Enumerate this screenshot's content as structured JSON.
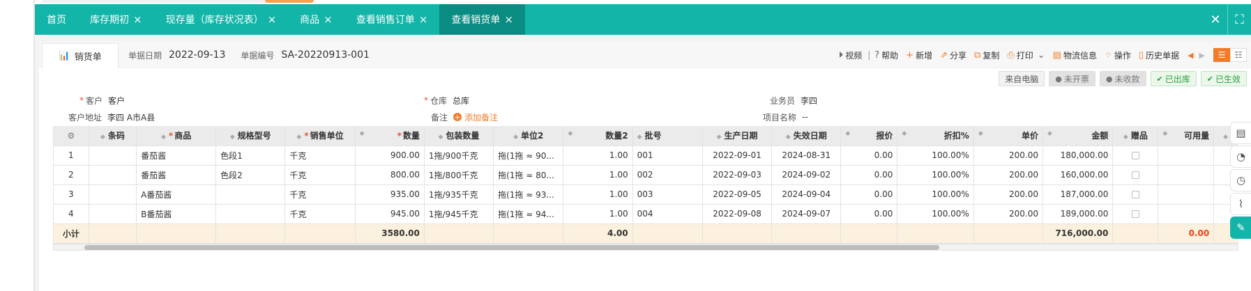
{
  "tabs": [
    {
      "label": "首页",
      "closable": false
    },
    {
      "label": "库存期初",
      "closable": true
    },
    {
      "label": "现存量（库存状况表）",
      "closable": true
    },
    {
      "label": "商品",
      "closable": true
    },
    {
      "label": "查看销售订单",
      "closable": true
    },
    {
      "label": "查看销货单",
      "closable": true,
      "active": true
    }
  ],
  "tab_close_glyph": "×",
  "tabbar_icons": {
    "close": "✕",
    "fullscreen": "⛶"
  },
  "doc": {
    "tab_label": "销货单",
    "date_label": "单据日期",
    "date_value": "2022-09-13",
    "number_label": "单据编号",
    "number_value": "SA-20220913-001"
  },
  "toolbar": {
    "video": "视频",
    "help": "帮助",
    "add": "新增",
    "share": "分享",
    "copy": "复制",
    "print": "打印",
    "logistics": "物流信息",
    "operate": "操作",
    "history": "历史单据",
    "separator": "|"
  },
  "badges": {
    "source": "来自电脑",
    "not_invoiced": "未开票",
    "not_collected": "未收款",
    "out_stock": "已出库",
    "effective": "已生效"
  },
  "form": {
    "customer_label": "客户",
    "customer_value": "客户",
    "warehouse_label": "仓库",
    "warehouse_value": "总库",
    "salesman_label": "业务员",
    "salesman_value": "李四",
    "address_label": "客户地址",
    "address_value": "李四 A市A县",
    "note_label": "备注",
    "add_note": "添加备注",
    "project_label": "项目名称",
    "project_value": "--"
  },
  "table": {
    "headers": [
      "条码",
      "商品",
      "规格型号",
      "销售单位",
      "数量",
      "包装数量",
      "单位2",
      "数量2",
      "批号",
      "生产日期",
      "失效日期",
      "报价",
      "折扣%",
      "单价",
      "金额",
      "赠品",
      "可用量"
    ],
    "rows": [
      {
        "no": "1",
        "barcode": "",
        "product": "番茄酱",
        "spec": "色段1",
        "unit": "千克",
        "qty": "900.00",
        "pack_qty": "1拖/900千克",
        "unit2": "拖(1拖 ≈ 90...",
        "qty2": "1.00",
        "batch": "001",
        "prod_date": "2022-09-01",
        "exp_date": "2024-08-31",
        "quote": "0.00",
        "discount": "100.00%",
        "price": "200.00",
        "amount": "180,000.00",
        "gift": false,
        "available": ""
      },
      {
        "no": "2",
        "barcode": "",
        "product": "番茄酱",
        "spec": "色段2",
        "unit": "千克",
        "qty": "800.00",
        "pack_qty": "1拖/800千克",
        "unit2": "拖(1拖 ≈ 80...",
        "qty2": "1.00",
        "batch": "002",
        "prod_date": "2022-09-03",
        "exp_date": "2024-09-02",
        "quote": "0.00",
        "discount": "100.00%",
        "price": "200.00",
        "amount": "160,000.00",
        "gift": false,
        "available": ""
      },
      {
        "no": "3",
        "barcode": "",
        "product": "A番茄酱",
        "spec": "",
        "unit": "千克",
        "qty": "935.00",
        "pack_qty": "1拖/935千克",
        "unit2": "拖(1拖 ≈ 93...",
        "qty2": "1.00",
        "batch": "003",
        "prod_date": "2022-09-05",
        "exp_date": "2024-09-04",
        "quote": "0.00",
        "discount": "100.00%",
        "price": "200.00",
        "amount": "187,000.00",
        "gift": false,
        "available": ""
      },
      {
        "no": "4",
        "barcode": "",
        "product": "B番茄酱",
        "spec": "",
        "unit": "千克",
        "qty": "945.00",
        "pack_qty": "1拖/945千克",
        "unit2": "拖(1拖 ≈ 94...",
        "qty2": "1.00",
        "batch": "004",
        "prod_date": "2022-09-08",
        "exp_date": "2024-09-07",
        "quote": "0.00",
        "discount": "100.00%",
        "price": "200.00",
        "amount": "189,000.00",
        "gift": false,
        "available": ""
      }
    ],
    "summary": {
      "label": "小计",
      "qty": "3580.00",
      "qty2": "4.00",
      "amount": "716,000.00",
      "available": "0.00"
    }
  },
  "colors": {
    "teal": "#13b5a8",
    "teal_active": "#0b8c82",
    "orange": "#f07c2a",
    "red": "#e8431a",
    "green": "#27a33c"
  },
  "icons": {
    "doc_tab": "chart-icon",
    "video": "play-circle-icon",
    "help": "question-circle-icon",
    "add": "plus-icon",
    "share": "share-icon",
    "copy": "copy-icon",
    "print": "printer-icon",
    "logistics": "truck-icon",
    "operate": "grid-icon",
    "history": "history-icon",
    "gear": "gear-icon"
  }
}
